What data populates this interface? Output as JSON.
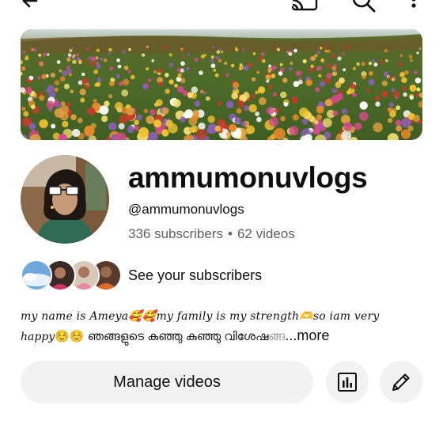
{
  "topbar": {
    "icons": [
      "back-arrow-icon",
      "cast-icon",
      "search-icon",
      "more-vert-icon"
    ]
  },
  "banner": {
    "description_icon": "flower-field-banner"
  },
  "channel": {
    "name": "ammumonuvlogs",
    "handle": "@ammumonuvlogs",
    "subscribers": "336 subscribers",
    "separator": "•",
    "videos": "62 videos"
  },
  "subscribers_row": {
    "label": "See your subscribers"
  },
  "description": {
    "line1_part1": "my name is Ameya",
    "emoji_love1": "🥰",
    "emoji_love2": "🥰",
    "line1_part2": "my family is my strength",
    "emoji_heart": "🫶",
    "line1_part3": "so iam very",
    "line2_part1": "happy",
    "emoji_smile1": "☺️",
    "emoji_smile2": "☺️",
    "line2_malayalam": " ഞങ്ങളുടെ കുഞ്ഞു കുഞ്ഞു വിശേഷ",
    "line2_fade": "ങ്ങ",
    "more": "...more"
  },
  "actions": {
    "manage_videos": "Manage videos",
    "analytics_icon": "analytics-icon",
    "edit_icon": "edit-pencil-icon"
  },
  "colors": {
    "text_primary": "#0f0f0f",
    "text_secondary": "#606060",
    "button_bg": "#f2f2f2"
  }
}
